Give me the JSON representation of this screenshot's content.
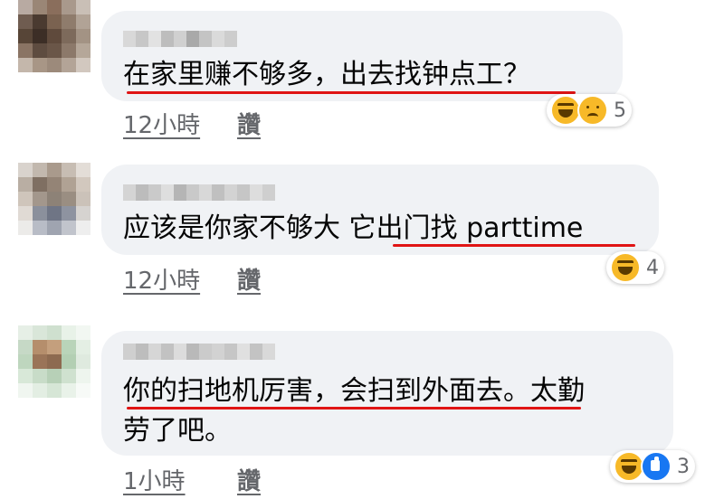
{
  "comments": [
    {
      "text_lines": [
        "在家里赚不够多，出去找钟点工？"
      ],
      "time": "12小時",
      "like_label": "讚",
      "reactions": [
        "haha-icon",
        "sad-icon"
      ],
      "reaction_count": "5"
    },
    {
      "text_lines": [
        "应该是你家不够大 它出门找 parttime"
      ],
      "time": "12小時",
      "like_label": "讚",
      "reactions": [
        "haha-icon"
      ],
      "reaction_count": "4"
    },
    {
      "text_lines": [
        "你的扫地机厉害，会扫到外面去。太勤",
        "劳了吧。"
      ],
      "time": "1小時",
      "like_label": "讚",
      "reactions": [
        "haha-icon",
        "like-icon"
      ],
      "reaction_count": "3"
    }
  ],
  "colors": {
    "bubble": "#f0f2f5",
    "underline": "#e01414",
    "meta_text": "#65676b",
    "like_blue": "#1877f2",
    "emoji_yellow": "#f7b928"
  }
}
